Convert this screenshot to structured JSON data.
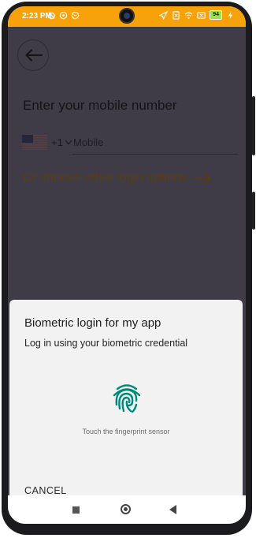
{
  "status_bar": {
    "time": "2:23 PM",
    "battery": "94",
    "color": "#f7a10b"
  },
  "login_screen": {
    "back_icon": "arrow-left-icon",
    "title": "Enter your mobile number",
    "country_flag": "us-flag-icon",
    "country_code": "+1",
    "mobile_placeholder": "Mobile",
    "other_options": "Or choose other login options"
  },
  "biometric_sheet": {
    "title": "Biometric login for my app",
    "subtitle": "Log in using your biometric credential",
    "fingerprint_icon": "fingerprint-icon",
    "accent_color": "#00897b",
    "hint": "Touch the fingerprint sensor",
    "cancel_label": "CANCEL"
  },
  "nav_bar": {
    "recents_icon": "square-icon",
    "home_icon": "circle-icon",
    "back_icon": "triangle-back-icon"
  }
}
